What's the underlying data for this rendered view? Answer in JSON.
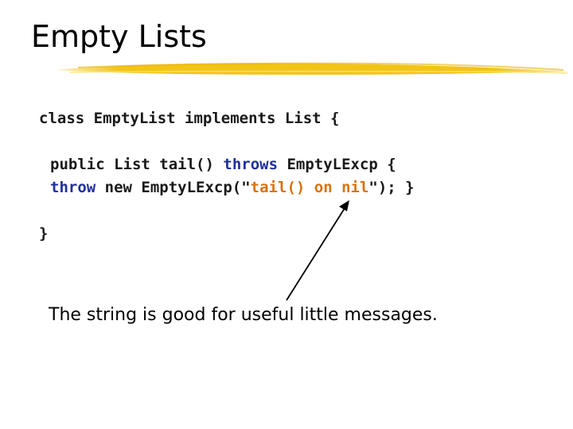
{
  "slide": {
    "title": "Empty Lists",
    "code": {
      "line1": "class EmptyList implements List {",
      "line2": {
        "part1": "public List tail",
        "paren": "()",
        "space1": " ",
        "kw_throws": "throws",
        "part2": " EmptyLExcp {"
      },
      "line3": {
        "kw_throw": "throw",
        "part1": " new EmptyLExcp(\"",
        "str_text": "tail",
        "str_paren": "()",
        "str_rest": " on nil",
        "part2": "\"); }"
      },
      "line4": "}"
    },
    "note": "The string is good for useful little messages.",
    "colors": {
      "keyword": "#1f2f9e",
      "string": "#d9720f",
      "underline_brush": "#f2c417"
    }
  }
}
